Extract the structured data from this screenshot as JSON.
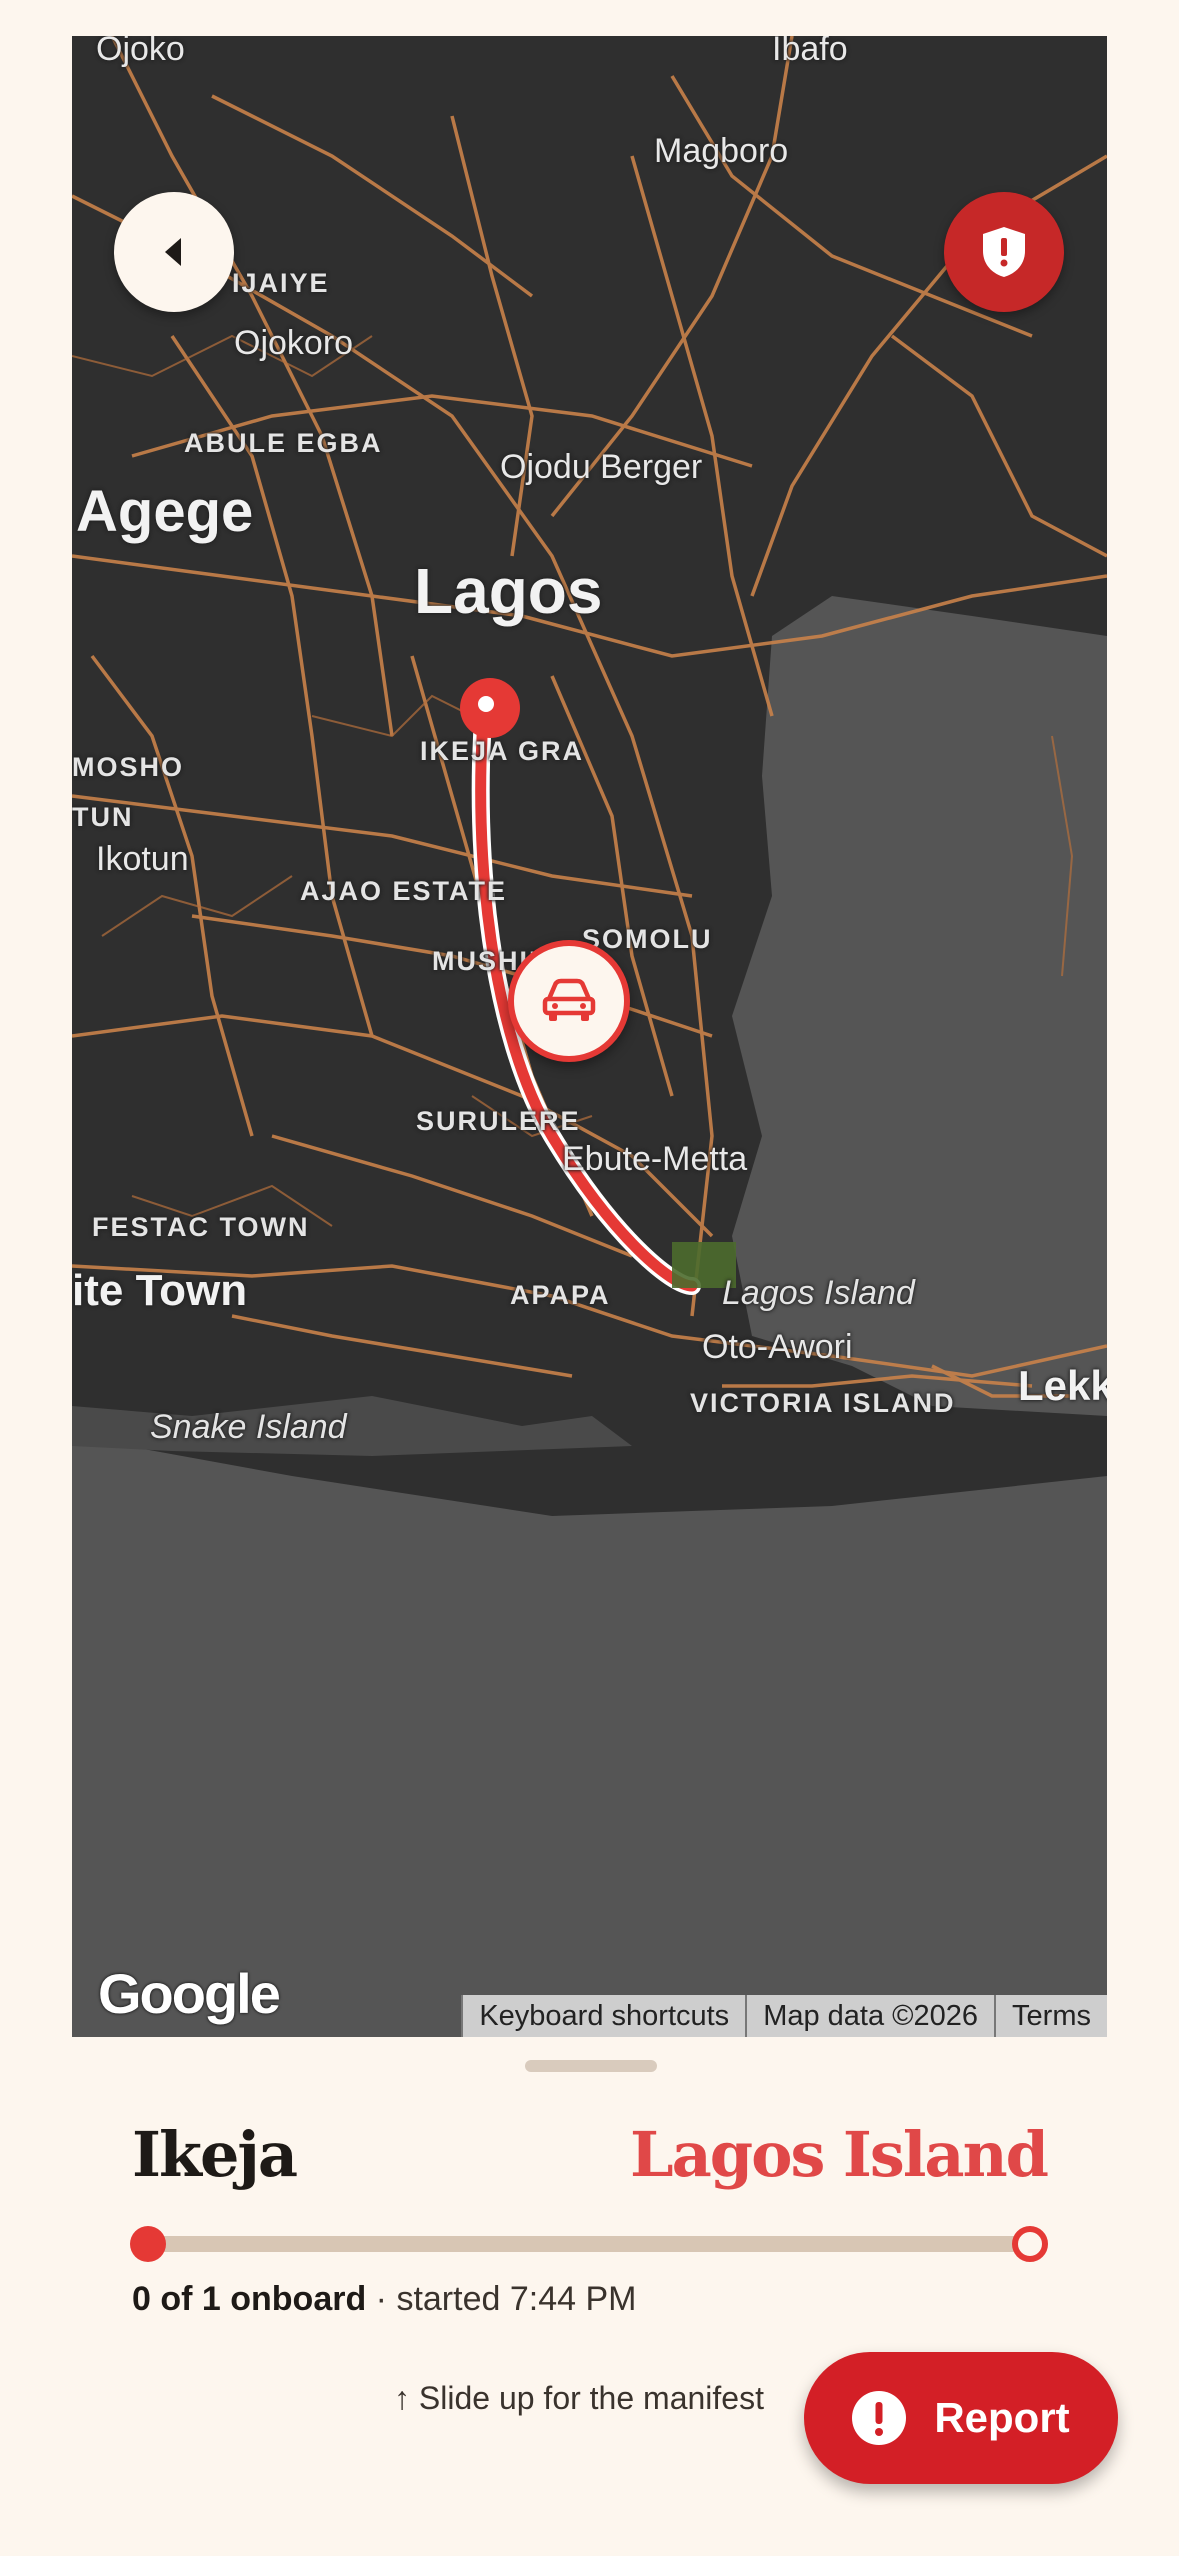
{
  "map": {
    "labels": {
      "ibafo": "Ibafo",
      "ojoko": "Ojoko",
      "magboro": "Magboro",
      "ijaiye": "IJAIYE",
      "ojokoro": "Ojokoro",
      "abule_egba": "ABULE EGBA",
      "ojodu_berger": "Ojodu Berger",
      "agege": "Agege",
      "lagos": "Lagos",
      "ikeja_gra": "IKEJA GRA",
      "mosho": "MOSHO",
      "tun": "TUN",
      "ikotun": "Ikotun",
      "ajao_estate": "AJAO ESTATE",
      "somolu": "SOMOLU",
      "mushin": "MUSHIN",
      "surulere": "SURULERE",
      "ebute_metta": "Ebute-Metta",
      "festac_town": "FESTAC TOWN",
      "satellite_town": "ite Town",
      "apapa": "APAPA",
      "lagos_island": "Lagos Island",
      "oto_awori": "Oto-Awori",
      "victoria_island": "VICTORIA ISLAND",
      "lekki": "Lekk",
      "snake_island": "Snake Island"
    },
    "attribution": {
      "logo": "Google",
      "keyboard_shortcuts": "Keyboard shortcuts",
      "map_data": "Map data ©2026",
      "terms": "Terms"
    },
    "icons": {
      "back": "chevron-left-icon",
      "sos": "shield-alert-icon",
      "vehicle": "car-icon"
    },
    "route_color": "#e53935"
  },
  "trip": {
    "origin": "Ikeja",
    "destination": "Lagos Island",
    "onboard": "0 of 1 onboard",
    "started": " · started 7:44 PM",
    "progress": 0.0
  },
  "sheet": {
    "hint": "↑ Slide up for the manifest",
    "report_label": "Report"
  },
  "colors": {
    "accent": "#e53935",
    "report": "#d31f26",
    "background": "#fdf6ee"
  }
}
